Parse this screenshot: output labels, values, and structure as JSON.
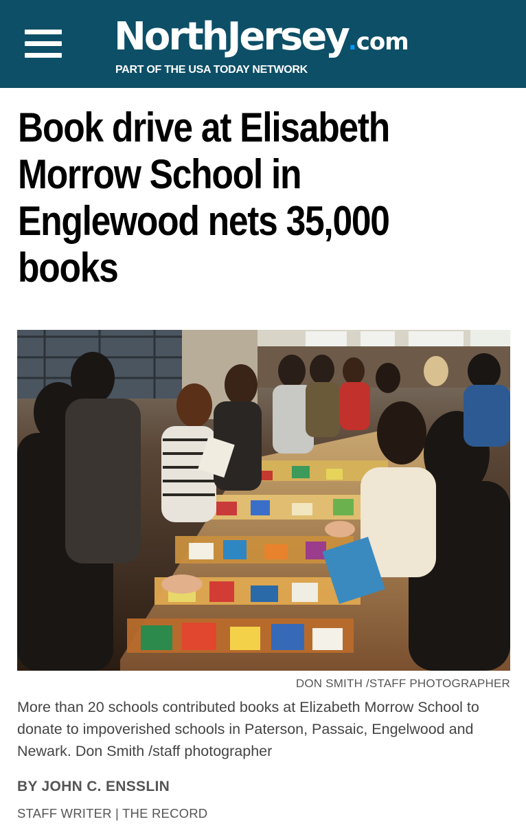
{
  "header": {
    "menu_icon": "hamburger-menu-icon",
    "logo_name": "NorthJersey",
    "logo_suffix": ".com",
    "tagline": "PART OF THE USA TODAY NETWORK",
    "background_color": "#0d4f67"
  },
  "article": {
    "headline": "Book drive at Elisabeth Morrow School in Englewood nets 35,000 books",
    "photo_credit": "DON SMITH /STAFF PHOTOGRAPHER",
    "photo_caption": "More than 20 schools contributed books at Elizabeth Morrow School to donate to impoverished schools in Paterson, Passaic, Engelwood and Newark. Don Smith /staff photographer",
    "byline": "BY JOHN C. ENSSLIN",
    "author_title": "STAFF WRITER | THE RECORD"
  }
}
